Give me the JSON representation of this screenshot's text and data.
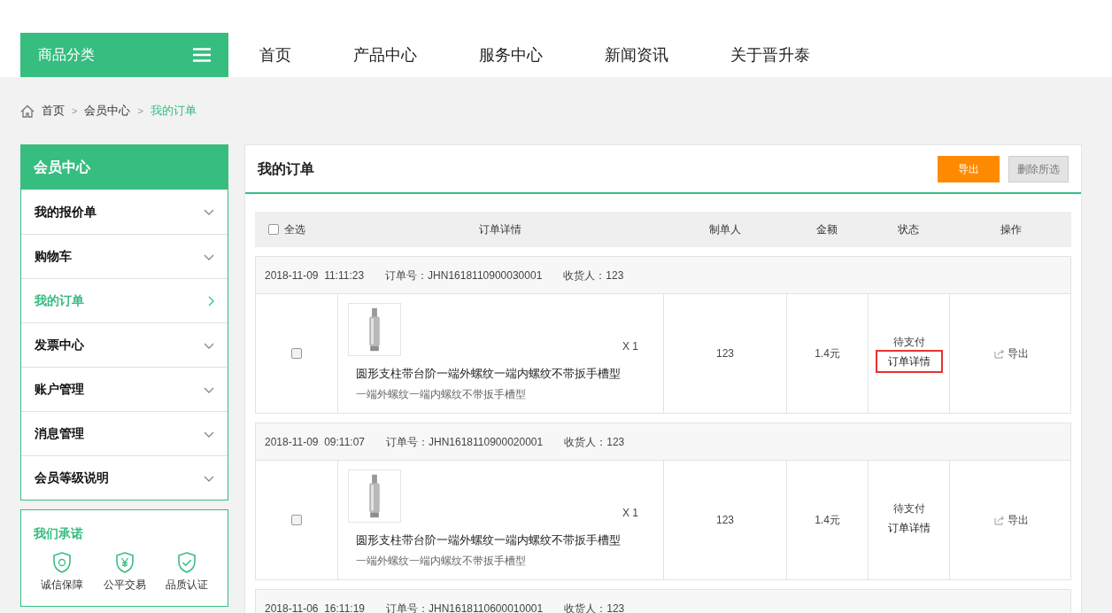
{
  "nav": {
    "category_button": "商品分类",
    "items": [
      {
        "label": "首页"
      },
      {
        "label": "产品中心"
      },
      {
        "label": "服务中心"
      },
      {
        "label": "新闻资讯"
      },
      {
        "label": "关于晋升泰"
      }
    ]
  },
  "breadcrumb_separator": ">",
  "breadcrumb": [
    {
      "label": "首页",
      "current": false
    },
    {
      "label": "会员中心",
      "current": false
    },
    {
      "label": "我的订单",
      "current": true
    }
  ],
  "sidebar": {
    "title": "会员中心",
    "items": [
      {
        "label": "我的报价单",
        "selected": false
      },
      {
        "label": "购物车",
        "selected": false
      },
      {
        "label": "我的订单",
        "selected": true
      },
      {
        "label": "发票中心",
        "selected": false
      },
      {
        "label": "账户管理",
        "selected": false
      },
      {
        "label": "消息管理",
        "selected": false
      },
      {
        "label": "会员等级说明",
        "selected": false
      }
    ]
  },
  "promise": {
    "title": "我们承诺",
    "items": [
      {
        "kind": "guarantee",
        "label": "诚信保障"
      },
      {
        "kind": "fair",
        "label": "公平交易"
      },
      {
        "kind": "quality",
        "label": "品质认证"
      }
    ]
  },
  "main": {
    "title": "我的订单",
    "buttons": [
      {
        "kind": "primary",
        "label": "导出"
      },
      {
        "kind": "secondary",
        "label": "删除所选"
      }
    ],
    "table": {
      "select_all": {
        "label": "全选",
        "checked": false
      },
      "columns": [
        "订单详情",
        "制单人",
        "金额",
        "状态",
        "操作"
      ],
      "orders": [
        {
          "date": "2018-11-09  11:11:23",
          "order_no": "订单号：JHN1618110900030001",
          "receiver": "收货人：123",
          "checked": false,
          "quantity": "X 1",
          "product": "圆形支柱带台阶一端外螺纹一端内螺纹不带扳手槽型",
          "spec": "一端外螺纹一端内螺纹不带扳手槽型",
          "creator": "123",
          "amount": "1.4元",
          "status": "待支付",
          "detail_link": "订单详情",
          "highlighted": true,
          "action": "导出"
        },
        {
          "date": "2018-11-09  09:11:07",
          "order_no": "订单号：JHN1618110900020001",
          "receiver": "收货人：123",
          "checked": false,
          "quantity": "X 1",
          "product": "圆形支柱带台阶一端外螺纹一端内螺纹不带扳手槽型",
          "spec": "一端外螺纹一端内螺纹不带扳手槽型",
          "creator": "123",
          "amount": "1.4元",
          "status": "待支付",
          "detail_link": "订单详情",
          "highlighted": false,
          "action": "导出"
        },
        {
          "date": "2018-11-06  16:11:19",
          "order_no": "订单号：JHN1618110600010001",
          "receiver": "收货人：123"
        }
      ]
    }
  }
}
